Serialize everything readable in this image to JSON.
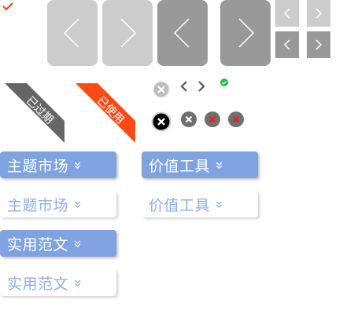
{
  "ribbons": {
    "expired": "已过期",
    "used": "已使用"
  },
  "tags": {
    "theme_market": "主题市场",
    "value_tools": "价值工具",
    "practical_writing": "实用范文"
  },
  "colors": {
    "accent_blue": "#7ea3e0",
    "ribbon_gray": "#666666",
    "ribbon_orange": "#ff4a14",
    "error_red": "#e02020",
    "success_green": "#2db84a"
  }
}
